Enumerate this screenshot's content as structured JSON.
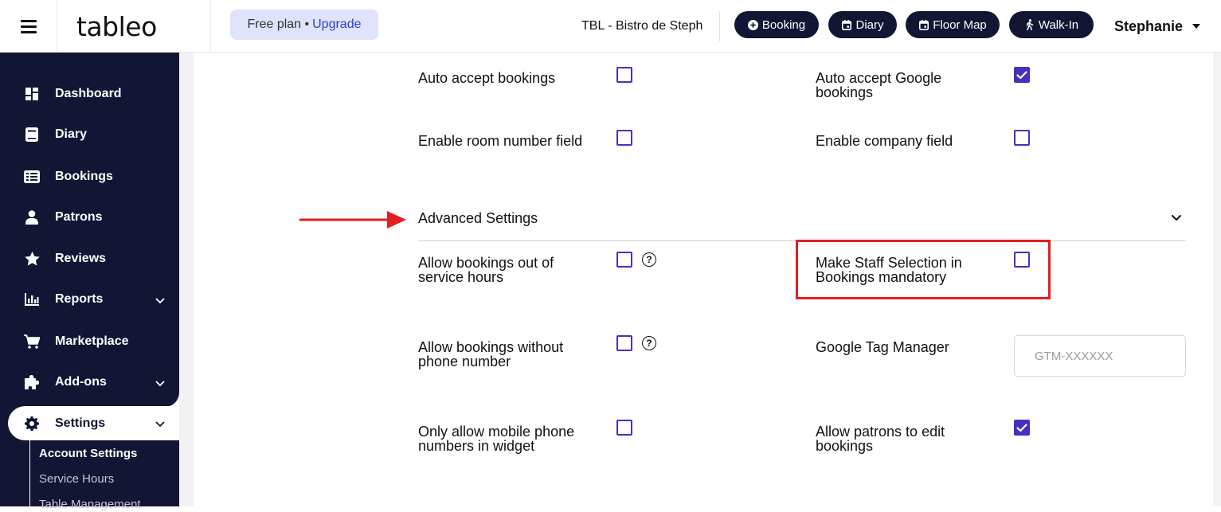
{
  "header": {
    "logo": "tableo",
    "plan": {
      "text": "Free plan •",
      "upgrade": "Upgrade"
    },
    "venue": "TBL - Bistro de Steph",
    "actions": [
      {
        "label": "Booking",
        "icon": "plus-circle-icon"
      },
      {
        "label": "Diary",
        "icon": "calendar-icon"
      },
      {
        "label": "Floor Map",
        "icon": "calendar-icon"
      },
      {
        "label": "Walk-In",
        "icon": "walking-icon"
      }
    ],
    "user": "Stephanie"
  },
  "sidebar": {
    "items": [
      {
        "label": "Dashboard",
        "icon": "dashboard-icon"
      },
      {
        "label": "Diary",
        "icon": "book-icon"
      },
      {
        "label": "Bookings",
        "icon": "list-icon"
      },
      {
        "label": "Patrons",
        "icon": "user-icon"
      },
      {
        "label": "Reviews",
        "icon": "star-icon"
      },
      {
        "label": "Reports",
        "icon": "chart-icon"
      },
      {
        "label": "Marketplace",
        "icon": "cart-icon"
      },
      {
        "label": "Add-ons",
        "icon": "puzzle-icon"
      },
      {
        "label": "Settings",
        "icon": "gear-icon"
      }
    ],
    "sub_items": [
      {
        "label": "Account Settings",
        "active": true
      },
      {
        "label": "Service Hours",
        "active": false
      },
      {
        "label": "Table Management",
        "active": false
      }
    ]
  },
  "settings": {
    "auto_accept": {
      "label": "Auto accept bookings",
      "checked": false
    },
    "auto_accept_google": {
      "label": "Auto accept Google bookings",
      "checked": true
    },
    "room_number": {
      "label": "Enable room number field",
      "checked": false
    },
    "company_field": {
      "label": "Enable company field",
      "checked": false
    },
    "advanced_title": "Advanced Settings",
    "out_of_hours": {
      "label": "Allow bookings out of service hours",
      "checked": false
    },
    "staff_mandatory": {
      "label": "Make Staff Selection in Bookings mandatory",
      "checked": false
    },
    "no_phone": {
      "label": "Allow bookings without phone number",
      "checked": false
    },
    "gtm": {
      "label": "Google Tag Manager",
      "value": "",
      "placeholder": "GTM-XXXXXX"
    },
    "mobile_only": {
      "label": "Only allow mobile phone numbers in widget",
      "checked": false
    },
    "patrons_edit": {
      "label": "Allow patrons to edit bookings",
      "checked": true
    }
  },
  "colors": {
    "navy": "#121634",
    "accent": "#4a2ec1",
    "highlight": "#e21f1f",
    "pill": "#dfe3fb"
  }
}
